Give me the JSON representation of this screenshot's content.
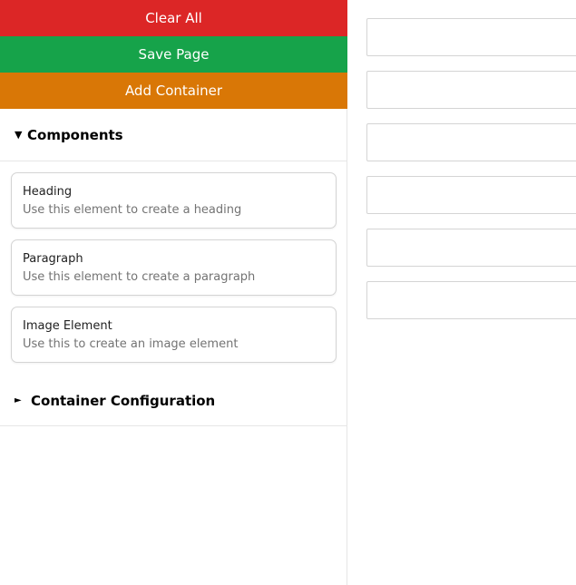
{
  "toolbar": {
    "clear_label": "Clear All",
    "save_label": "Save Page",
    "add_container_label": "Add Container"
  },
  "components_section": {
    "title": "Components",
    "expanded": true,
    "items": [
      {
        "title": "Heading",
        "description": "Use this element to create a heading"
      },
      {
        "title": "Paragraph",
        "description": "Use this element to create a paragraph"
      },
      {
        "title": "Image Element",
        "description": "Use this to create an image element"
      }
    ]
  },
  "container_config_section": {
    "title": "Container Configuration",
    "expanded": false
  },
  "canvas": {
    "container_count": 6
  },
  "colors": {
    "clear": "#dc2626",
    "save": "#16a34a",
    "add": "#d97706"
  },
  "icons": {
    "expanded_caret": "caret-down-icon",
    "collapsed_caret": "caret-right-icon"
  }
}
